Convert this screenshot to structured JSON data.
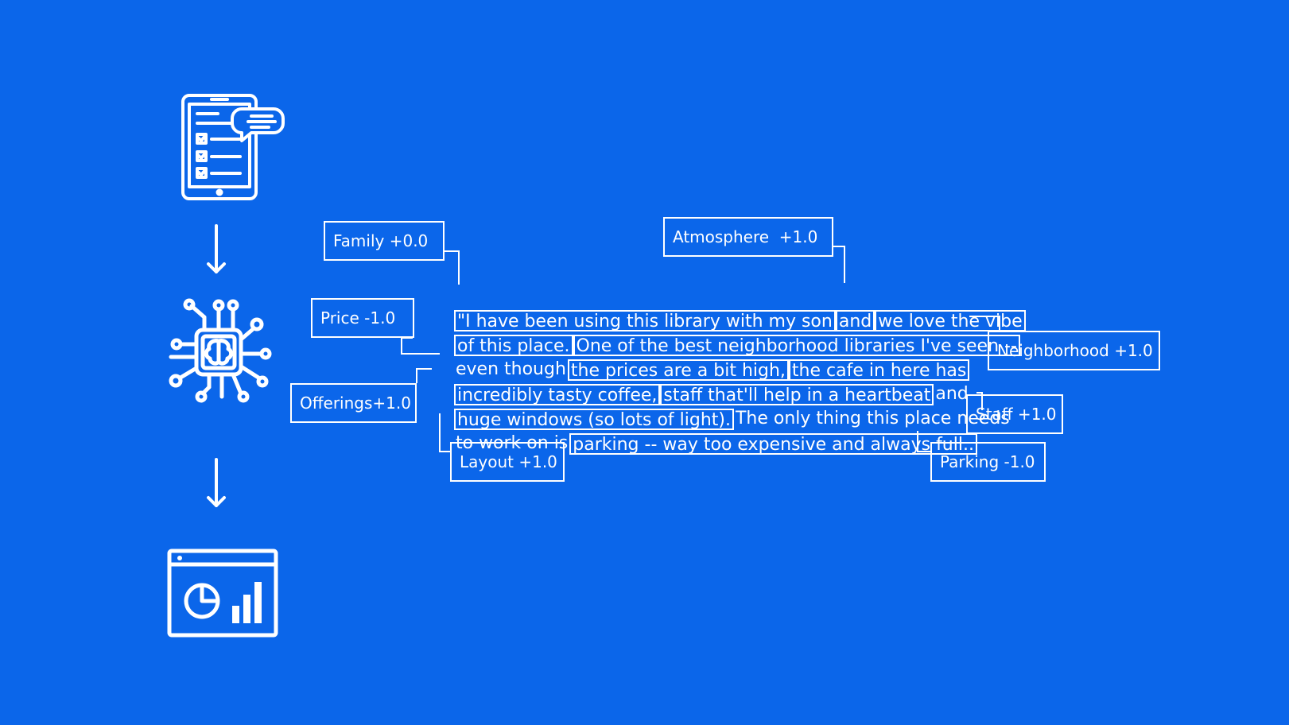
{
  "icons": {
    "input": "tablet-survey-icon",
    "model": "ai-brain-chip-icon",
    "output": "dashboard-chart-icon"
  },
  "labels": {
    "family": "Family +0.0",
    "atmosphere": "Atmosphere  +1.0",
    "price": "Price -1.0",
    "neighborhood": "Neighborhood +1.0",
    "offerings": "Offerings+1.0",
    "staff": "Staff +1.0",
    "layout": "Layout +1.0",
    "parking": "Parking -1.0"
  },
  "review_lines": [
    [
      {
        "text": "\"I have been using this library with my son",
        "boxed": true
      },
      {
        "text": "and",
        "boxed": true
      },
      {
        "text": "we love the vibe",
        "boxed": true
      }
    ],
    [
      {
        "text": "of this place.",
        "boxed": true
      },
      {
        "text": "One of the best neighborhood libraries I've seen --",
        "boxed": true
      }
    ],
    [
      {
        "text": "even though",
        "boxed": false
      },
      {
        "text": "the prices are a bit high,",
        "boxed": true
      },
      {
        "text": "the cafe in here has",
        "boxed": true
      }
    ],
    [
      {
        "text": "incredibly tasty coffee,",
        "boxed": true
      },
      {
        "text": "staff that'll help in a heartbeat",
        "boxed": true
      },
      {
        "text": "and",
        "boxed": false
      }
    ],
    [
      {
        "text": "huge windows (so lots of light).",
        "boxed": true
      },
      {
        "text": "The only thing this place needs",
        "boxed": false
      }
    ],
    [
      {
        "text": "to work on is",
        "boxed": false
      },
      {
        "text": "parking -- way too expensive and always full..",
        "boxed": true
      }
    ]
  ]
}
